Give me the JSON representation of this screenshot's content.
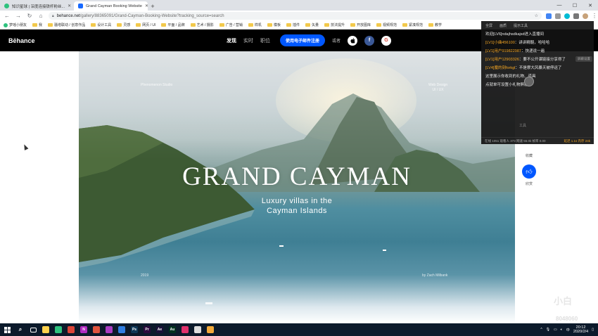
{
  "browser": {
    "tabs": [
      {
        "label": "知识星球 | 深度连接铁杆粉丝...",
        "fav_color": "#2ec27e",
        "active": false
      },
      {
        "label": "Grand Cayman Booking Website",
        "fav_color": "#1769ff",
        "active": true
      }
    ],
    "new_tab": "+",
    "window_controls": [
      "—",
      "☐",
      "✕"
    ],
    "url_host": "behance.net",
    "url_path": "/gallery/88365091/Grand-Cayman-Booking-Website?tracking_source=search",
    "bookmarks": [
      "梦瑶小朋友",
      "我",
      "骚塔联动 / 创意作品",
      "设计工具",
      "灵感",
      "网页 / UI",
      "平面 / 品牌",
      "艺术 / 摄影",
      "广告 / 营销",
      "样机",
      "模板",
      "插件",
      "矢量",
      "技法提升",
      "开放图库",
      "视频规范",
      "紧凑规范",
      "教学"
    ]
  },
  "behance": {
    "logo": "Bēhance",
    "nav": [
      {
        "label": "发现",
        "active": true
      },
      {
        "label": "实时",
        "active": false
      },
      {
        "label": "职位",
        "active": false
      }
    ],
    "signup": "使用电子邮件注册",
    "or": "或者",
    "social": {
      "apple": "",
      "facebook": "f",
      "google": "G"
    }
  },
  "hero": {
    "title": "GRAND CAYMAN",
    "subtitle_line1": "Luxury  villas in the",
    "subtitle_line2": "Cayman Islands",
    "corner_tl": "Phenomenon Studio",
    "corner_tr_line1": "Web Design",
    "corner_tr_line2": "UI / UX",
    "corner_bl": "2019",
    "corner_br": "by Zach Milbank"
  },
  "side": {
    "gift_label": "收藏",
    "like_label": "欣赏"
  },
  "chat": {
    "top_labels": [
      "全屏",
      "画质",
      "提示工具"
    ],
    "messages": [
      {
        "lv": "",
        "user": "",
        "text": "欢迎[LV6]ndajhsdkajsd进入直播间"
      },
      {
        "lv": "[LV1]",
        "user": "小曲456100",
        "text": "：讲讲精髓，哈哈哈"
      },
      {
        "lv": "[LV1]",
        "user": "用户919822987",
        "text": "：快递说一遍"
      },
      {
        "lv": "[LV1]",
        "user": "用户12903326",
        "text": "：要不公开课链接分享得了"
      },
      {
        "lv": "[LV4]",
        "user": "魔的刻forkgl",
        "text": "：不是摩大风暴天被停运了"
      },
      {
        "lv": "",
        "user": "",
        "text": "这里展示你收到的礼物、道具"
      },
      {
        "lv": "",
        "user": "",
        "text": "点就单可设置小礼物屏蔽"
      }
    ],
    "badge": "屏蔽设置",
    "footer_left": "在线 1051 观看人 373 网速 55.0k 帧率 0.00",
    "footer_right": "延迟 1.1s 内存 24k",
    "tool_label": "工具"
  },
  "watermark": {
    "line1": "小白",
    "line2": "8048060"
  },
  "taskbar": {
    "apps": [
      {
        "label": "",
        "color": "#ffd24d"
      },
      {
        "label": "",
        "color": "#2ec27e"
      },
      {
        "label": "",
        "color": "#db4437"
      },
      {
        "label": "N",
        "color": "#b12ac0"
      },
      {
        "label": "",
        "color": "#e0543f"
      },
      {
        "label": "",
        "color": "#a93cc3"
      },
      {
        "label": "",
        "color": "#2f7de1"
      },
      {
        "label": "Ps",
        "color": "#0f3757"
      },
      {
        "label": "Pr",
        "color": "#2a0a3d"
      },
      {
        "label": "Ae",
        "color": "#1a1038"
      },
      {
        "label": "Au",
        "color": "#00311f"
      },
      {
        "label": "",
        "color": "#e1306c"
      },
      {
        "label": "",
        "color": "#dddddd"
      },
      {
        "label": "",
        "color": "#f2a93b"
      }
    ],
    "time": "20:12",
    "date": "2020/2/4",
    "ime": "中"
  }
}
